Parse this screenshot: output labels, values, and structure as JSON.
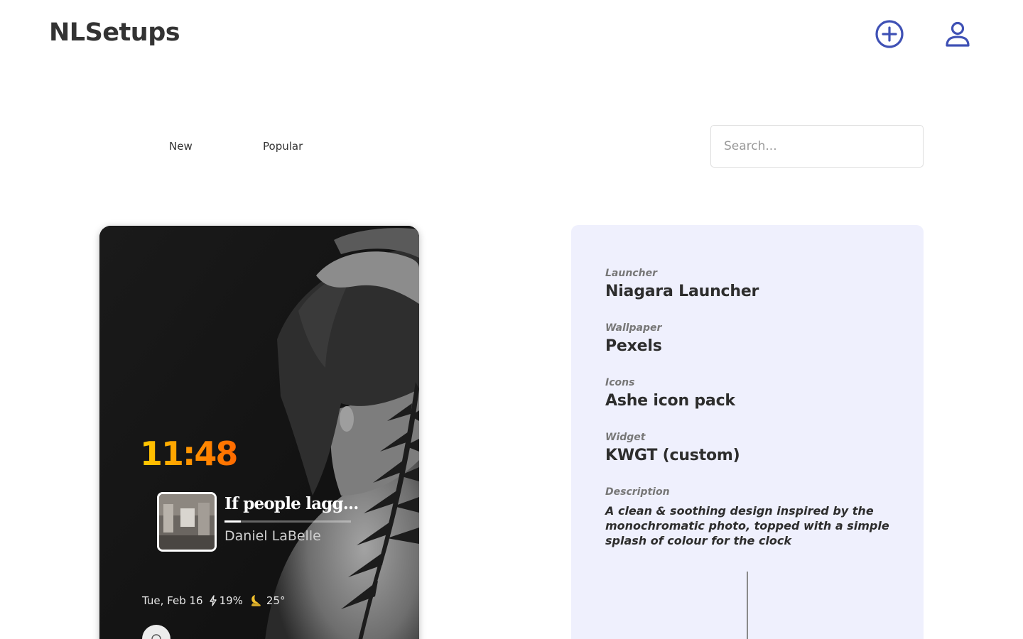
{
  "header": {
    "brand": "NLSetups",
    "add_icon": "plus-circle-icon",
    "profile_icon": "user-icon"
  },
  "tabs": [
    {
      "label": "New"
    },
    {
      "label": "Popular"
    }
  ],
  "search": {
    "placeholder": "Search...",
    "value": ""
  },
  "preview": {
    "clock": "11:48",
    "media": {
      "title": "If people lagg...",
      "artist": "Daniel LaBelle",
      "progress": 0.13
    },
    "status": {
      "date": "Tue, Feb 16",
      "battery": "19%",
      "temperature": "25°",
      "battery_icon": "bolt-icon",
      "weather_icon": "moon-cloud-icon"
    }
  },
  "details": {
    "launcher": {
      "label": "Launcher",
      "value": "Niagara Launcher"
    },
    "wallpaper": {
      "label": "Wallpaper",
      "value": "Pexels"
    },
    "icons": {
      "label": "Icons",
      "value": "Ashe icon pack"
    },
    "widget": {
      "label": "Widget",
      "value": "KWGT (custom)"
    },
    "description": {
      "label": "Description",
      "value": "A clean & soothing design inspired by the monochromatic photo, topped with a simple splash of colour for the clock"
    }
  },
  "colors": {
    "accent": "#3f51b5",
    "panel_bg": "#eff0fd",
    "clock_gradient": [
      "#ffcc00",
      "#ff6a00"
    ]
  }
}
